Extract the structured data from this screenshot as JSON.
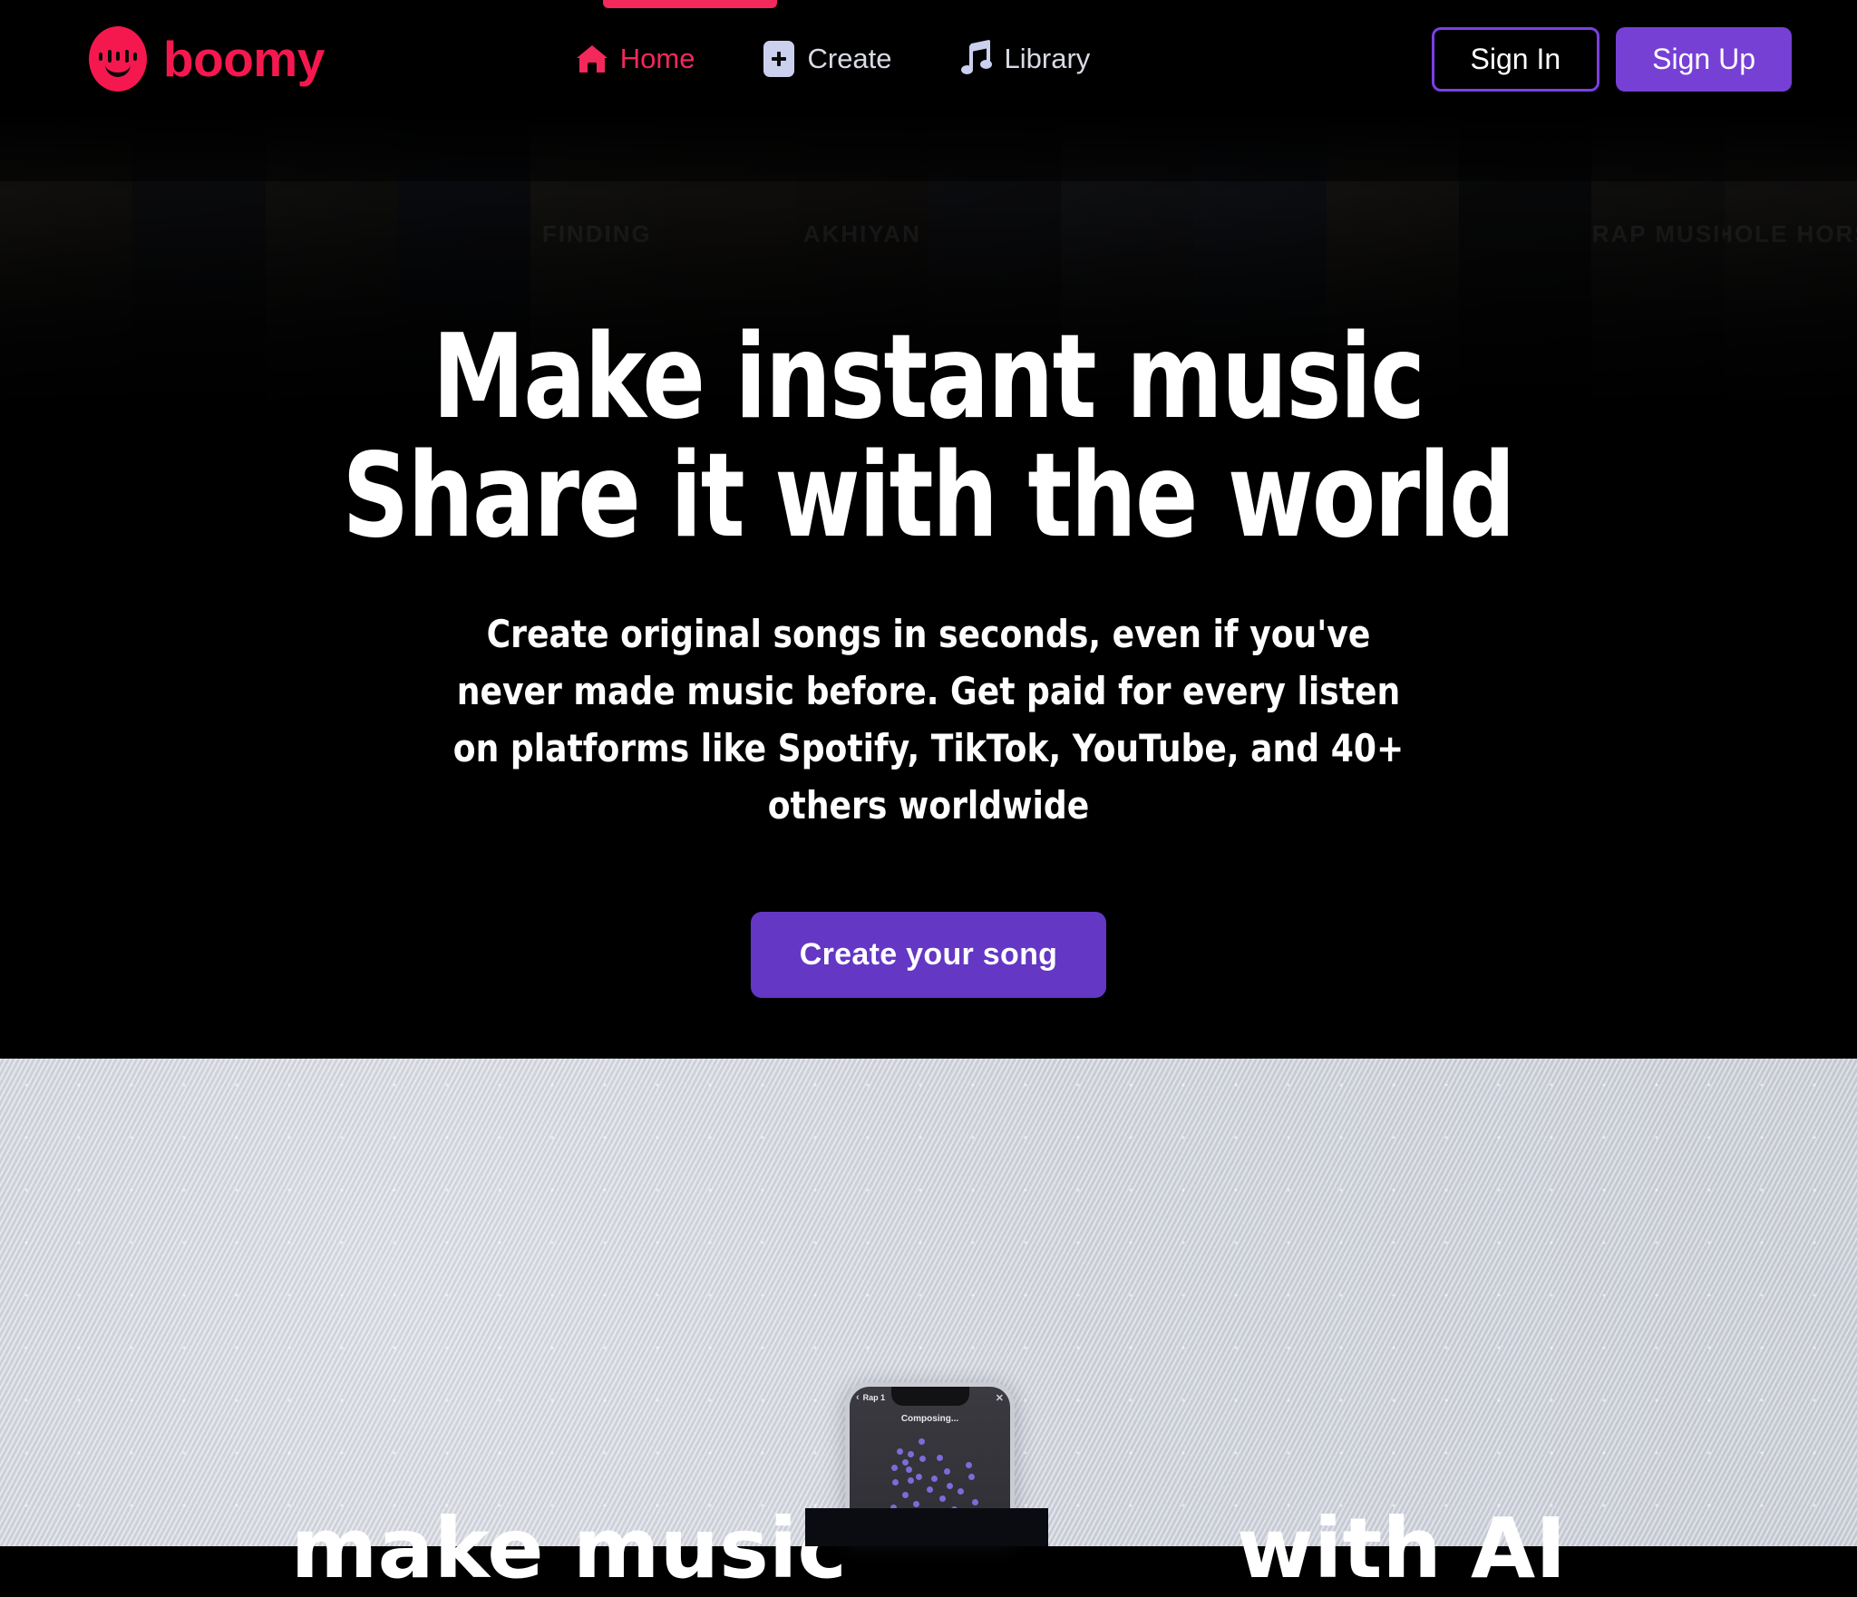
{
  "brand": {
    "name": "boomy",
    "logo_icon": "boomy-face-logo",
    "color": "#f5184f"
  },
  "nav": {
    "items": [
      {
        "label": "Home",
        "icon": "home-icon",
        "active": true
      },
      {
        "label": "Create",
        "icon": "plus-square-icon",
        "active": false
      },
      {
        "label": "Library",
        "icon": "music-note-icon",
        "active": false
      }
    ],
    "active_indicator_color": "#f3285b"
  },
  "auth": {
    "sign_in_label": "Sign In",
    "sign_up_label": "Sign Up",
    "sign_in_border_color": "#7b3fe4",
    "sign_up_bg_color": "#7640d4"
  },
  "hero": {
    "headline_line1": "Make instant music",
    "headline_line2": "Share it with the world",
    "subheadline": "Create original songs in seconds, even if you've never made music before. Get paid for every listen on platforms like Spotify, TikTok, YouTube, and 40+ others worldwide",
    "cta_label": "Create your song",
    "cta_bg_color": "#6437c4",
    "background_color": "#000000",
    "collage_tiles": [
      "",
      "",
      "",
      "",
      "AKHIYAN",
      "FINDING",
      "",
      "",
      "",
      "TRAP MUSIC",
      "WHOLE HORSE"
    ]
  },
  "light_section": {
    "headline_left": "make music",
    "headline_right": "with AI",
    "background_color": "#d3d6de",
    "phone": {
      "title": "Rap 1",
      "back_icon": "chevron-left-icon",
      "close_icon": "close-icon",
      "status": "Composing...",
      "dot_color": "#7b6cd9"
    }
  }
}
